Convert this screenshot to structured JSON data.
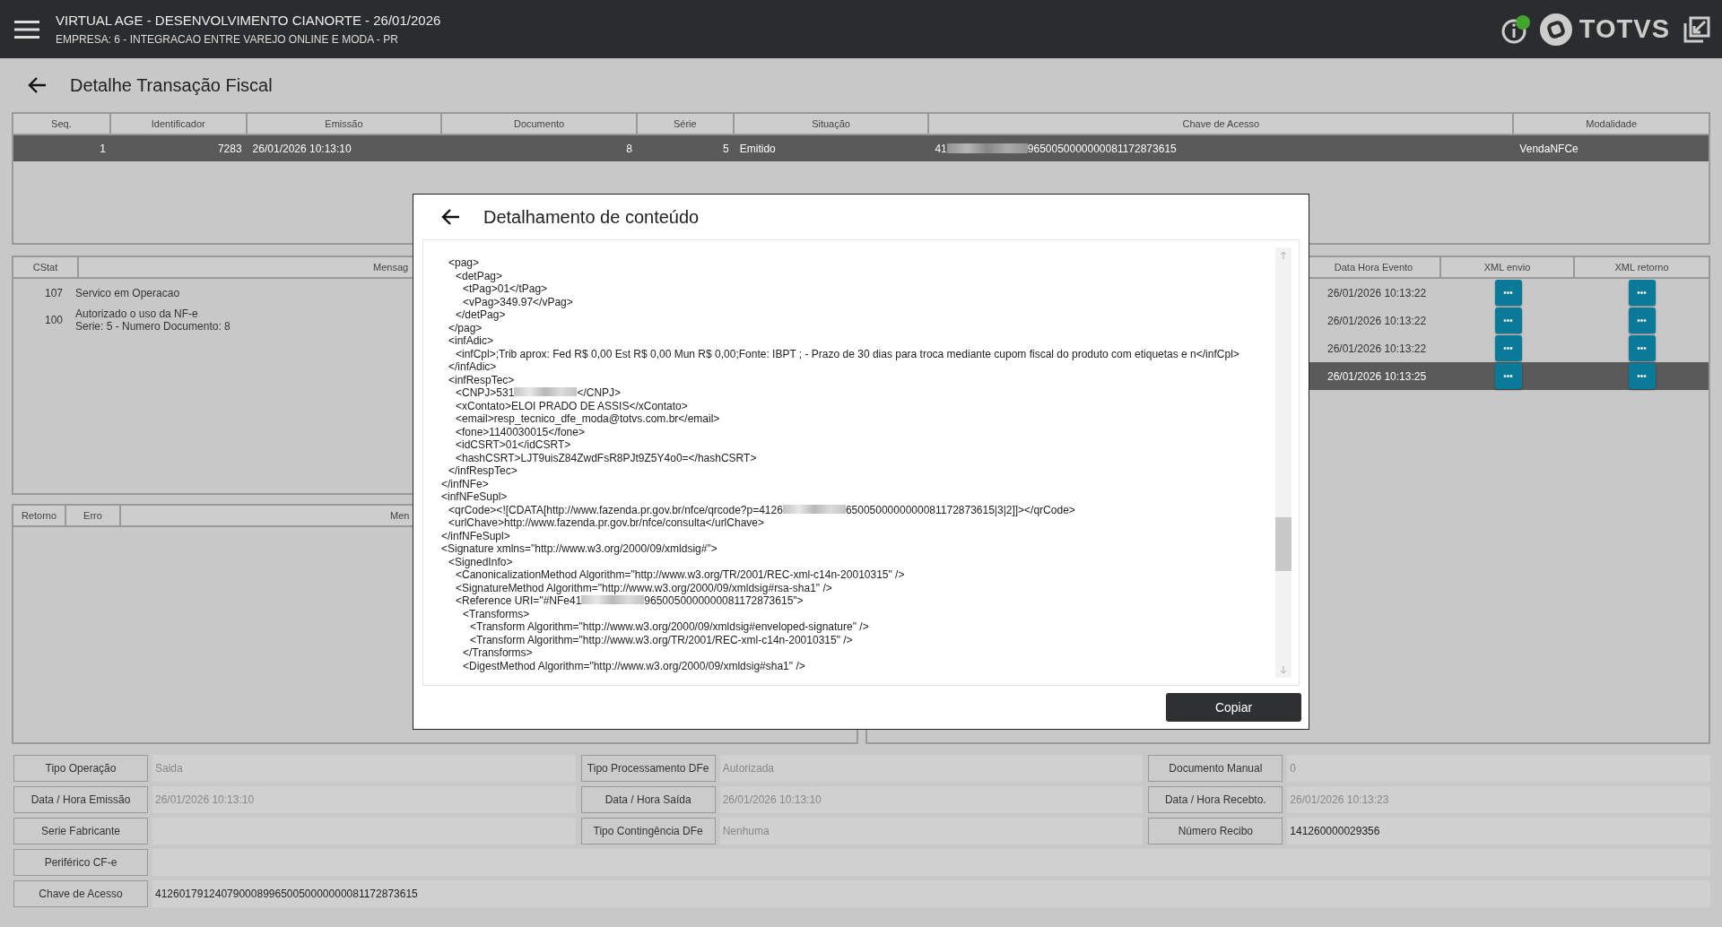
{
  "app_bar": {
    "title": "VIRTUAL AGE - DESENVOLVIMENTO CIANORTE - 26/01/2026",
    "subtitle": "EMPRESA: 6 - INTEGRACAO ENTRE VAREJO ONLINE E MODA - PR",
    "status_online": true,
    "brand": "TOTVS"
  },
  "page_title": "Detalhe Transação Fiscal",
  "transactions": {
    "columns": [
      "Seq.",
      "Identificador",
      "Emissão",
      "Documento",
      "Série",
      "Situação",
      "Chave de Acesso",
      "Modalidade"
    ],
    "rows": [
      {
        "selected": true,
        "cells": [
          {
            "text": "1"
          },
          {
            "text": "7283"
          },
          {
            "text": "26/01/2026 10:13:10"
          },
          {
            "text": "8"
          },
          {
            "text": "5"
          },
          {
            "text": "Emitido"
          },
          {
            "parts": [
              "41",
              "9650050000000081172873615"
            ]
          },
          {
            "text": "VendaNFCe"
          }
        ]
      }
    ]
  },
  "status_messages": {
    "columns": [
      "CStat",
      "Mensag"
    ],
    "rows": [
      {
        "cstat": "107",
        "message": "Servico em Operacao"
      },
      {
        "cstat": "100",
        "message": "Autorizado o uso da NF-e\nSerie: 5 - Numero Documento: 8"
      }
    ]
  },
  "errors": {
    "columns": [
      "Retorno",
      "Erro",
      "Men"
    ]
  },
  "events": {
    "columns": [
      "Data Hora Evento",
      "XML envio",
      "XML retorno"
    ],
    "rows": [
      {
        "date": "26/01/2026 10:13:22",
        "selected": false,
        "send_button": "•••",
        "return_button": "•••"
      },
      {
        "date": "26/01/2026 10:13:22",
        "selected": false,
        "send_button": "•••",
        "return_button": "•••"
      },
      {
        "date": "26/01/2026 10:13:22",
        "selected": false,
        "send_button": "•••",
        "return_button": "•••"
      },
      {
        "date": "26/01/2026 10:13:25",
        "selected": true,
        "send_button": "•••",
        "return_button": "•••"
      }
    ]
  },
  "form": [
    {
      "label": "Tipo Operação",
      "value": "Saida",
      "disabled": true
    },
    {
      "label": "Tipo Processamento DFe",
      "value": "Autorizada",
      "disabled": true
    },
    {
      "label": "Documento Manual",
      "value": "0",
      "disabled": true
    },
    {
      "label": "Data / Hora Emissão",
      "value": "26/01/2026 10:13:10",
      "disabled": true
    },
    {
      "label": "Data / Hora Saída",
      "value": "26/01/2026 10:13:10",
      "disabled": true
    },
    {
      "label": "Data / Hora Recebto.",
      "value": "26/01/2026 10:13:23",
      "disabled": true
    },
    {
      "label": "Serie Fabricante"
    },
    {
      "label": "Tipo Contingência DFe",
      "value": "Nenhuma",
      "disabled": true
    },
    {
      "label": "Número Recibo",
      "value": "141260000029356",
      "disabled": false
    },
    {
      "label": "Periférico CF-e",
      "wide": true
    },
    {
      "label": "Chave de Acesso",
      "value": "41260179124079000899650050000000081172873615",
      "disabled": false,
      "wide": true
    }
  ],
  "dialog": {
    "title": "Detalhamento de conteúdo",
    "button": "Copiar",
    "lines": [
      {
        "children": [
          {
            "text": "<pag>",
            "children": [
              {
                "text": "<detPag>",
                "children": [
                  {
                    "text": "<tPag>01</tPag>"
                  },
                  {
                    "text": "<vPag>349.97</vPag>"
                  }
                ]
              },
              {
                "text": "</detPag>"
              }
            ]
          },
          {
            "text": "</pag>"
          },
          {
            "text": "<infAdic>",
            "children": [
              {
                "text": "<infCpl>;Trib aprox: Fed R$ 0,00 Est R$ 0,00 Mun R$ 0,00;Fonte: IBPT ; - Prazo de 30 dias para troca mediante cupom fiscal do produto com etiquetas e n</infCpl>"
              }
            ]
          },
          {
            "text": "</infAdic>"
          },
          {
            "text": "<infRespTec>",
            "children": [
              {
                "parts": [
                  "<CNPJ>531",
                  "</CNPJ>"
                ]
              },
              {
                "text": "<xContato>ELOI PRADO DE ASSIS</xContato>"
              },
              {
                "text": "<email>resp_tecnico_dfe_moda@totvs.com.br</email>"
              },
              {
                "text": "<fone>1140030015</fone>"
              },
              {
                "text": "<idCSRT>01</idCSRT>"
              },
              {
                "text": "<hashCSRT>LJT9uisZ84ZwdFsR8PJt9Z5Y4o0=</hashCSRT>"
              }
            ]
          },
          {
            "text": "</infRespTec>"
          }
        ]
      },
      {
        "text": "</infNFe>"
      },
      {
        "text": "<infNFeSupl>",
        "children": [
          {
            "parts": [
              "<qrCode><![CDATA[http://www.fazenda.pr.gov.br/nfce/qrcode?p=4126",
              "6500500000000081172873615|3|2]]></qrCode>"
            ]
          },
          {
            "text": "<urlChave>http://www.fazenda.pr.gov.br/nfce/consulta</urlChave>"
          }
        ]
      },
      {
        "text": "</infNFeSupl>"
      },
      {
        "text": "<Signature xmlns=\"http://www.w3.org/2000/09/xmldsig#\">",
        "children": [
          {
            "text": "<SignedInfo>",
            "children": [
              {
                "text": "<CanonicalizationMethod Algorithm=\"http://www.w3.org/TR/2001/REC-xml-c14n-20010315\" />"
              },
              {
                "text": "<SignatureMethod Algorithm=\"http://www.w3.org/2000/09/xmldsig#rsa-sha1\" />"
              },
              {
                "parts": [
                  "<Reference URI=\"#NFe41",
                  "9650050000000081172873615\">"
                ],
                "children": [
                  {
                    "text": "<Transforms>",
                    "children": [
                      {
                        "text": "<Transform Algorithm=\"http://www.w3.org/2000/09/xmldsig#enveloped-signature\" />"
                      },
                      {
                        "text": "<Transform Algorithm=\"http://www.w3.org/TR/2001/REC-xml-c14n-20010315\" />"
                      }
                    ]
                  },
                  {
                    "text": "</Transforms>"
                  },
                  {
                    "text": "<DigestMethod Algorithm=\"http://www.w3.org/2000/09/xmldsig#sha1\" />"
                  }
                ]
              }
            ]
          }
        ]
      }
    ]
  }
}
